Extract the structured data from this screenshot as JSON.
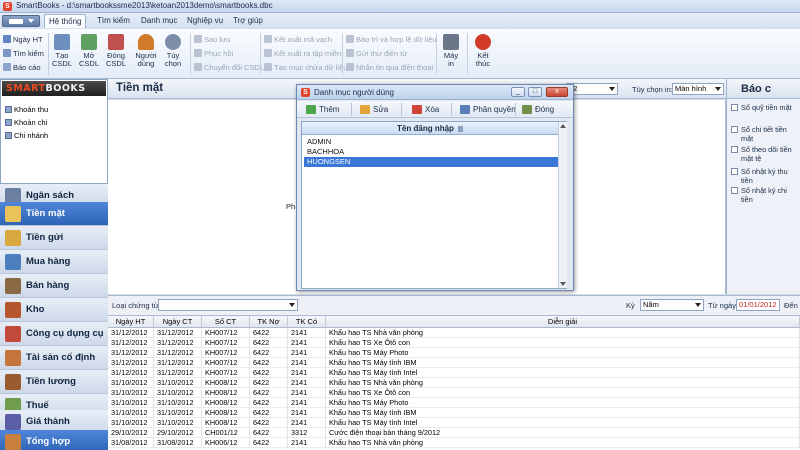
{
  "window": {
    "title": "SmartBooks - d:\\smartbookssme2013\\ketoan2013demo\\smartbooks.dbc",
    "logo_letter": "S"
  },
  "menu": {
    "items": [
      "Hệ thống",
      "Tìm kiếm",
      "Danh mục",
      "Nghiệp vụ",
      "Trợ giúp"
    ],
    "active": "Hệ thống"
  },
  "ribbon": {
    "left_small": [
      "Ngày HT",
      "Tìm kiếm",
      "Báo cáo"
    ],
    "big": [
      {
        "label1": "Tạo",
        "label2": "CSDL",
        "icon": "database-new-icon",
        "color": "#6d8fbf"
      },
      {
        "label1": "Mở",
        "label2": "CSDL",
        "icon": "database-open-icon",
        "color": "#5f9f5f"
      },
      {
        "label1": "Đóng",
        "label2": "CSDL",
        "icon": "database-close-icon",
        "color": "#c0504d"
      },
      {
        "label1": "Người",
        "label2": "dùng",
        "icon": "user-icon",
        "color": "#d27a2c"
      },
      {
        "label1": "Tùy",
        "label2": "chọn",
        "icon": "options-icon",
        "color": "#7d8ea8"
      }
    ],
    "group_backup": [
      "Sao lưu",
      "Phục hồi",
      "Chuyển đổi CSDL"
    ],
    "group_export": [
      "Kết xuất mã vạch",
      "Kết xuất ra tập miền",
      "Tạo mục chứa dữ liệu"
    ],
    "group_maint": [
      "Bảo trì và hợp lệ dữ liệu",
      "Gửi thư điện tử",
      "Nhắn tin qua điện thoại"
    ],
    "printer": {
      "label1": "Máy",
      "label2": "in",
      "icon": "printer-icon"
    },
    "exit": {
      "label1": "Kết",
      "label2": "thúc",
      "icon": "power-icon",
      "color": "#d23b2a"
    }
  },
  "navtree": {
    "logo_part1": "SMART",
    "logo_part2": "BOOKS",
    "items": [
      "Khoản thu",
      "Khoản chi",
      "Chi nhánh"
    ]
  },
  "nav": {
    "items": [
      {
        "label": "Ngân sách",
        "icon": "budget-icon",
        "color": "#6a7fa2"
      },
      {
        "label": "Tiền mặt",
        "icon": "cash-icon",
        "color": "#e7c35a",
        "active": true
      },
      {
        "label": "Tiền gửi",
        "icon": "bank-icon",
        "color": "#d8a840"
      },
      {
        "label": "Mua hàng",
        "icon": "cart-icon",
        "color": "#4d7fbf"
      },
      {
        "label": "Bán hàng",
        "icon": "sales-icon",
        "color": "#8a6a44"
      },
      {
        "label": "Kho",
        "icon": "warehouse-icon",
        "color": "#b5562f"
      },
      {
        "label": "Công cụ dụng cụ",
        "icon": "tools-icon",
        "color": "#c24a3a"
      },
      {
        "label": "Tài sản cố định",
        "icon": "asset-icon",
        "color": "#c3753b"
      },
      {
        "label": "Tiền lương",
        "icon": "salary-icon",
        "color": "#9a5c2e"
      },
      {
        "label": "Thuế",
        "icon": "tax-icon",
        "color": "#6f9d4b"
      },
      {
        "label": "Giá thành",
        "icon": "cost-icon",
        "color": "#5b5ea6"
      },
      {
        "label": "Tổng hợp",
        "icon": "summary-icon",
        "color": "#c97f3e",
        "active": true
      }
    ]
  },
  "main": {
    "title": "Tiền mặt",
    "period_combo": "02",
    "option_label": "Tùy chọn in:",
    "option_value": "Màn hình",
    "stray_text": "Ph"
  },
  "report_panel": {
    "title": "Báo c",
    "items": [
      "Sổ quỹ tiền mặt",
      "Sổ chi tiết tiền mặt",
      "Sổ theo dõi tiền mặt tệ",
      "Sổ nhật ký thu tiền",
      "Sổ nhật ký chi tiền"
    ]
  },
  "filter": {
    "doc_type_label": "Loại chứng từ",
    "doc_type_value": "",
    "period_label": "Kỳ",
    "period_value": "Năm",
    "from_label": "Từ ngày",
    "from_value": "01/01/2012",
    "to_label": "Đến"
  },
  "grid": {
    "columns": [
      "Ngày HT",
      "Ngày CT",
      "Số CT",
      "TK Nợ",
      "TK Có",
      "Diễn giải"
    ],
    "rows": [
      [
        "31/12/2012",
        "31/12/2012",
        "KH007/12",
        "6422",
        "2141",
        "Khấu hao TS Nhà văn phòng"
      ],
      [
        "31/12/2012",
        "31/12/2012",
        "KH007/12",
        "6422",
        "2141",
        "Khấu hao TS Xe Ôtô con"
      ],
      [
        "31/12/2012",
        "31/12/2012",
        "KH007/12",
        "6422",
        "2141",
        "Khấu hao TS Máy Photo"
      ],
      [
        "31/12/2012",
        "31/12/2012",
        "KH007/12",
        "6422",
        "2141",
        "Khấu hao TS Máy tính IBM"
      ],
      [
        "31/12/2012",
        "31/12/2012",
        "KH007/12",
        "6422",
        "2141",
        "Khấu hao TS Máy tính Intel"
      ],
      [
        "31/10/2012",
        "31/10/2012",
        "KH008/12",
        "6422",
        "2141",
        "Khấu hao TS Nhà văn phòng"
      ],
      [
        "31/10/2012",
        "31/10/2012",
        "KH008/12",
        "6422",
        "2141",
        "Khấu hao TS Xe Ôtô con"
      ],
      [
        "31/10/2012",
        "31/10/2012",
        "KH008/12",
        "6422",
        "2141",
        "Khấu hao TS Máy Photo"
      ],
      [
        "31/10/2012",
        "31/10/2012",
        "KH008/12",
        "6422",
        "2141",
        "Khấu hao TS Máy tính IBM"
      ],
      [
        "31/10/2012",
        "31/10/2012",
        "KH008/12",
        "6422",
        "2141",
        "Khấu hao TS Máy tính Intel"
      ],
      [
        "29/10/2012",
        "29/10/2012",
        "CH001/12",
        "6422",
        "3312",
        "Cước điện thoại bàn tháng 9/2012"
      ],
      [
        "31/08/2012",
        "31/08/2012",
        "KH006/12",
        "6422",
        "2141",
        "Khấu hao TS Nhà văn phòng"
      ]
    ]
  },
  "dialog": {
    "title": "Danh mục người dùng",
    "logo_letter": "S",
    "controls": {
      "min": "_",
      "max": "□",
      "close": "x"
    },
    "toolbar": [
      {
        "label": "Thêm",
        "icon": "add-icon",
        "color": "#4fa54b"
      },
      {
        "label": "Sửa",
        "icon": "edit-icon",
        "color": "#e0a43a"
      },
      {
        "label": "Xóa",
        "icon": "delete-icon",
        "color": "#d0453a"
      },
      {
        "label": "Phân quyền",
        "icon": "permissions-icon",
        "color": "#5a7fb8"
      },
      {
        "label": "Đóng",
        "icon": "close-door-icon",
        "color": "#6f8f4a"
      }
    ],
    "list_header": "Tên đăng nhập",
    "users": [
      "ADMIN",
      "BACHHOA",
      "HUONGSEN"
    ],
    "selected_user": "HUONGSEN"
  }
}
